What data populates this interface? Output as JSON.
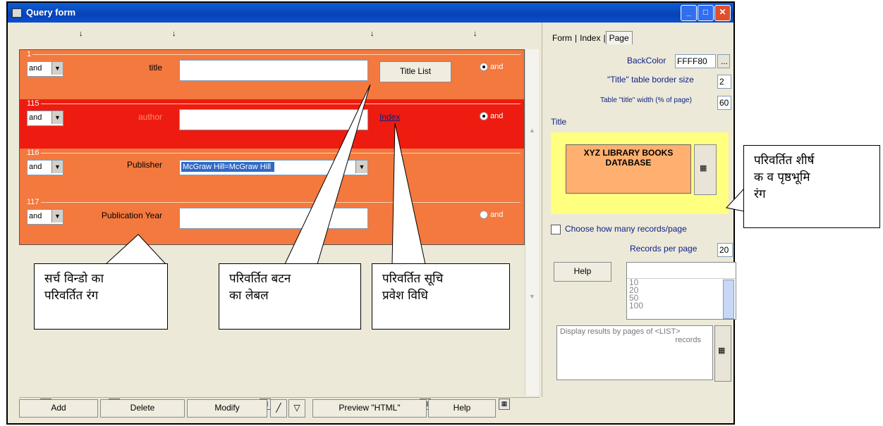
{
  "window": {
    "title": "Query form"
  },
  "column_markers": [
    "↓",
    "↓",
    "↓",
    "↓"
  ],
  "rows": [
    {
      "num": "1",
      "op": "and",
      "label": "title",
      "value": "",
      "button": "Title List",
      "radio": "and"
    },
    {
      "num": "115",
      "op": "and",
      "label": "author",
      "value": "",
      "link": "Index",
      "radio": "and"
    },
    {
      "num": "116",
      "op": "and",
      "label": "Publisher",
      "select": "McGraw Hill=McGraw Hill"
    },
    {
      "num": "117",
      "op": "and",
      "label": "Publication Year",
      "value": "",
      "radio": "and"
    }
  ],
  "buttons": {
    "add": "Add",
    "delete": "Delete",
    "modify": "Modify",
    "preview": "Preview \"HTML\"",
    "help": "Help"
  },
  "right_panel": {
    "tabs": [
      "Form",
      "Index",
      "Page"
    ],
    "active_tab": "Page",
    "backcolor_label": "BackColor",
    "backcolor_value": "FFFF80",
    "border_label": "\"Title\" table border size",
    "border_value": "2",
    "width_label": "Table \"title\" width (% of page)",
    "width_value": "60",
    "title_section": "Title",
    "title_line1": "XYZ LIBRARY BOOKS",
    "title_line2": "DATABASE",
    "choose_label": "Choose how many records/page",
    "records_label": "Records per page",
    "records_value": "20",
    "help": "Help",
    "list_options": [
      "10",
      "20",
      "50",
      "100"
    ],
    "display_text_1": "Display results by pages of <LIST>",
    "display_text_2": "records"
  },
  "callouts": {
    "search_window": [
      "सर्च विन्डो का",
      "परिवर्तित रंग"
    ],
    "button_label": [
      "परिवर्तित बटन",
      "का लेबल"
    ],
    "index_entry": [
      "परिवर्तित सूचि",
      "प्रवेश विधि"
    ],
    "title_bg": [
      "परिवर्तित शीर्ष",
      "क व पृष्ठभूमि",
      "रंग"
    ]
  },
  "colors": {
    "title_bar": "#0842b5",
    "row_orange": "#f3793f",
    "row_red": "#ee1c10",
    "title_bg": "#ffff80"
  }
}
